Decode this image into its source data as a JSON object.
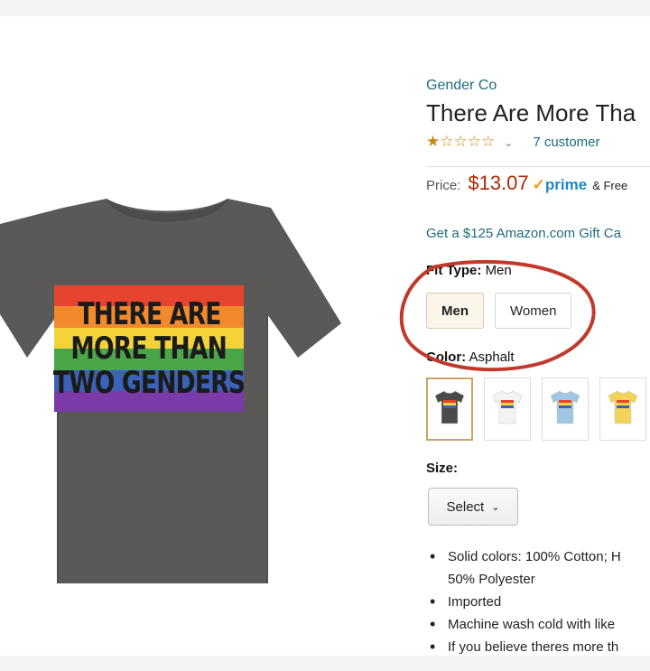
{
  "product": {
    "brand": "Gender Co",
    "title": "There Are More Tha",
    "rating": {
      "stars_filled": 1,
      "stars_total": 5,
      "reviews_text": "7 customer"
    },
    "price": {
      "label": "Price:",
      "amount": "$13.07",
      "prime": "prime",
      "shipping_text": "& Free"
    },
    "promo_text": "Get a $125 Amazon.com Gift Ca",
    "fit_type": {
      "label": "Fit Type:",
      "value": "Men",
      "options": [
        "Men",
        "Women"
      ],
      "selected": "Men"
    },
    "color": {
      "label": "Color:",
      "value": "Asphalt",
      "swatches": [
        {
          "name": "Asphalt",
          "hex": "#4a4a4a",
          "selected": true
        },
        {
          "name": "White",
          "hex": "#f3f3f3",
          "selected": false
        },
        {
          "name": "Light Blue",
          "hex": "#9fc6e3",
          "selected": false
        },
        {
          "name": "Yellow",
          "hex": "#f2d35a",
          "selected": false
        }
      ]
    },
    "size": {
      "label": "Size:",
      "select_label": "Select"
    },
    "bullets": [
      {
        "text": "Solid colors: 100% Cotton; H",
        "cont": "50% Polyester"
      },
      {
        "text": "Imported"
      },
      {
        "text": "Machine wash cold with like"
      },
      {
        "text": "If you believe theres more th"
      }
    ]
  },
  "shirt_print": {
    "lines": [
      "THERE ARE",
      "MORE THAN",
      "TWO GENDERS"
    ],
    "rainbow": [
      "#e6442f",
      "#f08a2c",
      "#f4d23a",
      "#4aa648",
      "#3b62b7",
      "#7a3aa8"
    ]
  },
  "colors": {
    "link": "#1f6b7d",
    "price": "#b12704",
    "prime": "#1e88c7",
    "star": "#c98a13",
    "annotation_circle": "#c0392b",
    "shirt": "#5a5958"
  }
}
